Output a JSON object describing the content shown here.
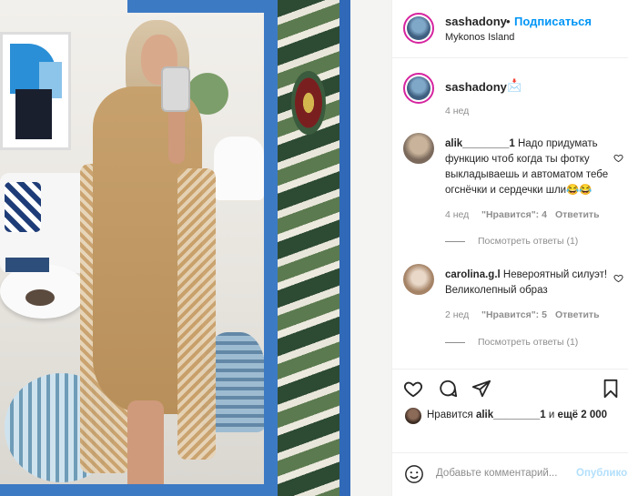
{
  "post": {
    "author": {
      "username": "sashadony",
      "separator": "•",
      "follow_label": "Подписаться",
      "location": "Mykonos Island"
    },
    "caption": {
      "username": "sashadony",
      "emoji": "📩",
      "time": "4 нед"
    },
    "comments": [
      {
        "username": "alik________1",
        "text": "Надо придумать функцию чтоб когда ты фотку выкладываешь и автоматом тебе огснёчки и сердечки шли😂😂",
        "line1": "Надо придумать",
        "line2": "функцию чтоб когда ты фотку",
        "line3": "выкладываешь и автоматом тебе",
        "line4": "огснёчки и сердечки шли😂😂",
        "time": "4 нед",
        "likes": "\"Нравится\": 4",
        "reply_label": "Ответить",
        "view_replies": "Посмотреть ответы (1)"
      },
      {
        "username": "carolina.g.l",
        "line1": "Невероятный силуэт!",
        "line2": "Великолепный образ",
        "time": "2 нед",
        "likes": "\"Нравится\": 5",
        "reply_label": "Ответить",
        "view_replies": "Посмотреть ответы (1)"
      }
    ],
    "likes_summary": {
      "prefix": "Нравится",
      "user": "alik________1",
      "middle": "и",
      "others": "ещё 2 000"
    },
    "add_comment": {
      "placeholder": "Добавьте комментарий...",
      "post_label": "Опубликовать"
    }
  },
  "icons": {
    "like": "heart-icon",
    "comment": "comment-icon",
    "share": "share-icon",
    "save": "bookmark-icon",
    "emoji": "emoji-icon"
  },
  "colors": {
    "link_blue": "#0095f6",
    "text": "#262626",
    "muted": "#8e8e8e",
    "story_ring": "#d6249f"
  }
}
